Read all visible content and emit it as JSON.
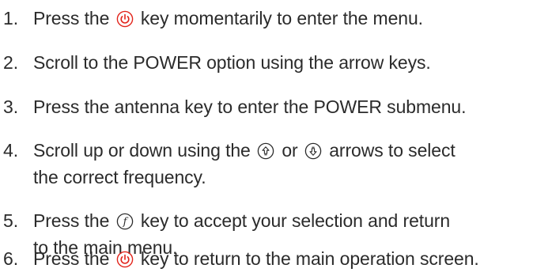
{
  "steps": [
    {
      "number": "1.",
      "before": "Press the",
      "icon": "power-icon",
      "after": "key momentarily to enter the menu."
    },
    {
      "number": "2.",
      "text": "Scroll to the POWER option using the arrow keys."
    },
    {
      "number": "3.",
      "text": "Press the antenna key to enter the POWER submenu."
    },
    {
      "number": "4.",
      "part1": "Scroll up or down using the",
      "icon1": "arrow-up-icon",
      "part2": "or",
      "icon2": "arrow-down-icon",
      "part3": "arrows to select",
      "line2": "the correct frequency."
    },
    {
      "number": "5.",
      "before": "Press the",
      "icon": "function-icon",
      "after": "key to accept your selection and return",
      "line2": "to the main menu."
    },
    {
      "number": "6.",
      "before": "Press the",
      "icon": "power-icon",
      "after": "key to return to the main operation screen."
    }
  ],
  "colors": {
    "text": "#2b2b2b",
    "power_icon": "#e2231a",
    "arrow_icon": "#2b2b2b",
    "function_icon": "#2b2b2b"
  }
}
